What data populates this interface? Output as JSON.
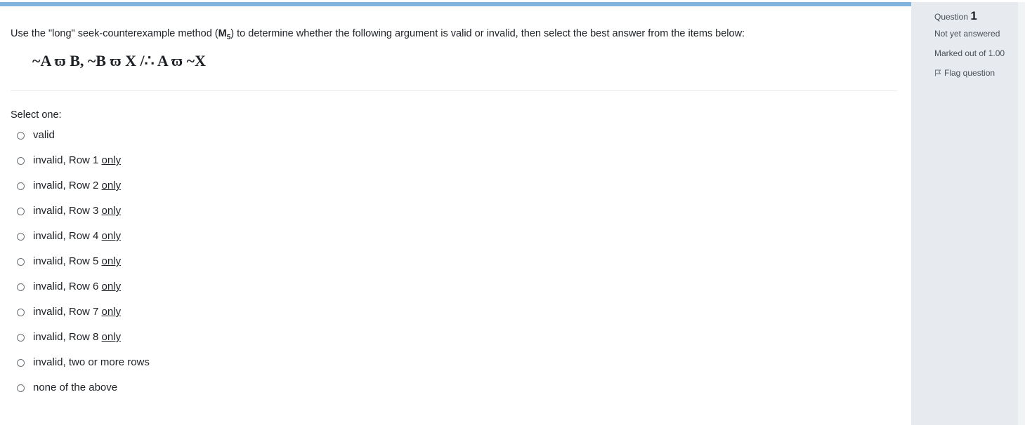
{
  "question": {
    "prompt_before": "Use the \"long\" seek-counterexample method (",
    "method_bold": "M",
    "method_sub": "5",
    "prompt_after": ") to determine whether the following argument is valid or invalid, then select the best answer from the items below:",
    "formula": "~A ϖ B, ~B ϖ X /∴ A ϖ ~X",
    "select_label": "Select one:",
    "options": [
      {
        "text": "valid",
        "underlined": ""
      },
      {
        "text": "invalid, Row 1 ",
        "underlined": "only"
      },
      {
        "text": "invalid, Row 2 ",
        "underlined": "only"
      },
      {
        "text": "invalid, Row 3 ",
        "underlined": "only"
      },
      {
        "text": "invalid, Row 4 ",
        "underlined": "only"
      },
      {
        "text": "invalid, Row 5 ",
        "underlined": "only"
      },
      {
        "text": "invalid, Row 6 ",
        "underlined": "only"
      },
      {
        "text": "invalid, Row 7 ",
        "underlined": "only"
      },
      {
        "text": "invalid, Row 8 ",
        "underlined": "only"
      },
      {
        "text": "invalid, two or more rows",
        "underlined": ""
      },
      {
        "text": "none of the above",
        "underlined": ""
      }
    ]
  },
  "info": {
    "question_label": "Question ",
    "question_number": "1",
    "status": "Not yet answered",
    "marks": "Marked out of 1.00",
    "flag_label": "Flag question",
    "flag_icon": "flag-icon"
  },
  "colors": {
    "top_bar": "#80b4de",
    "info_panel_bg": "#e7eaee",
    "text": "#1d2125"
  }
}
